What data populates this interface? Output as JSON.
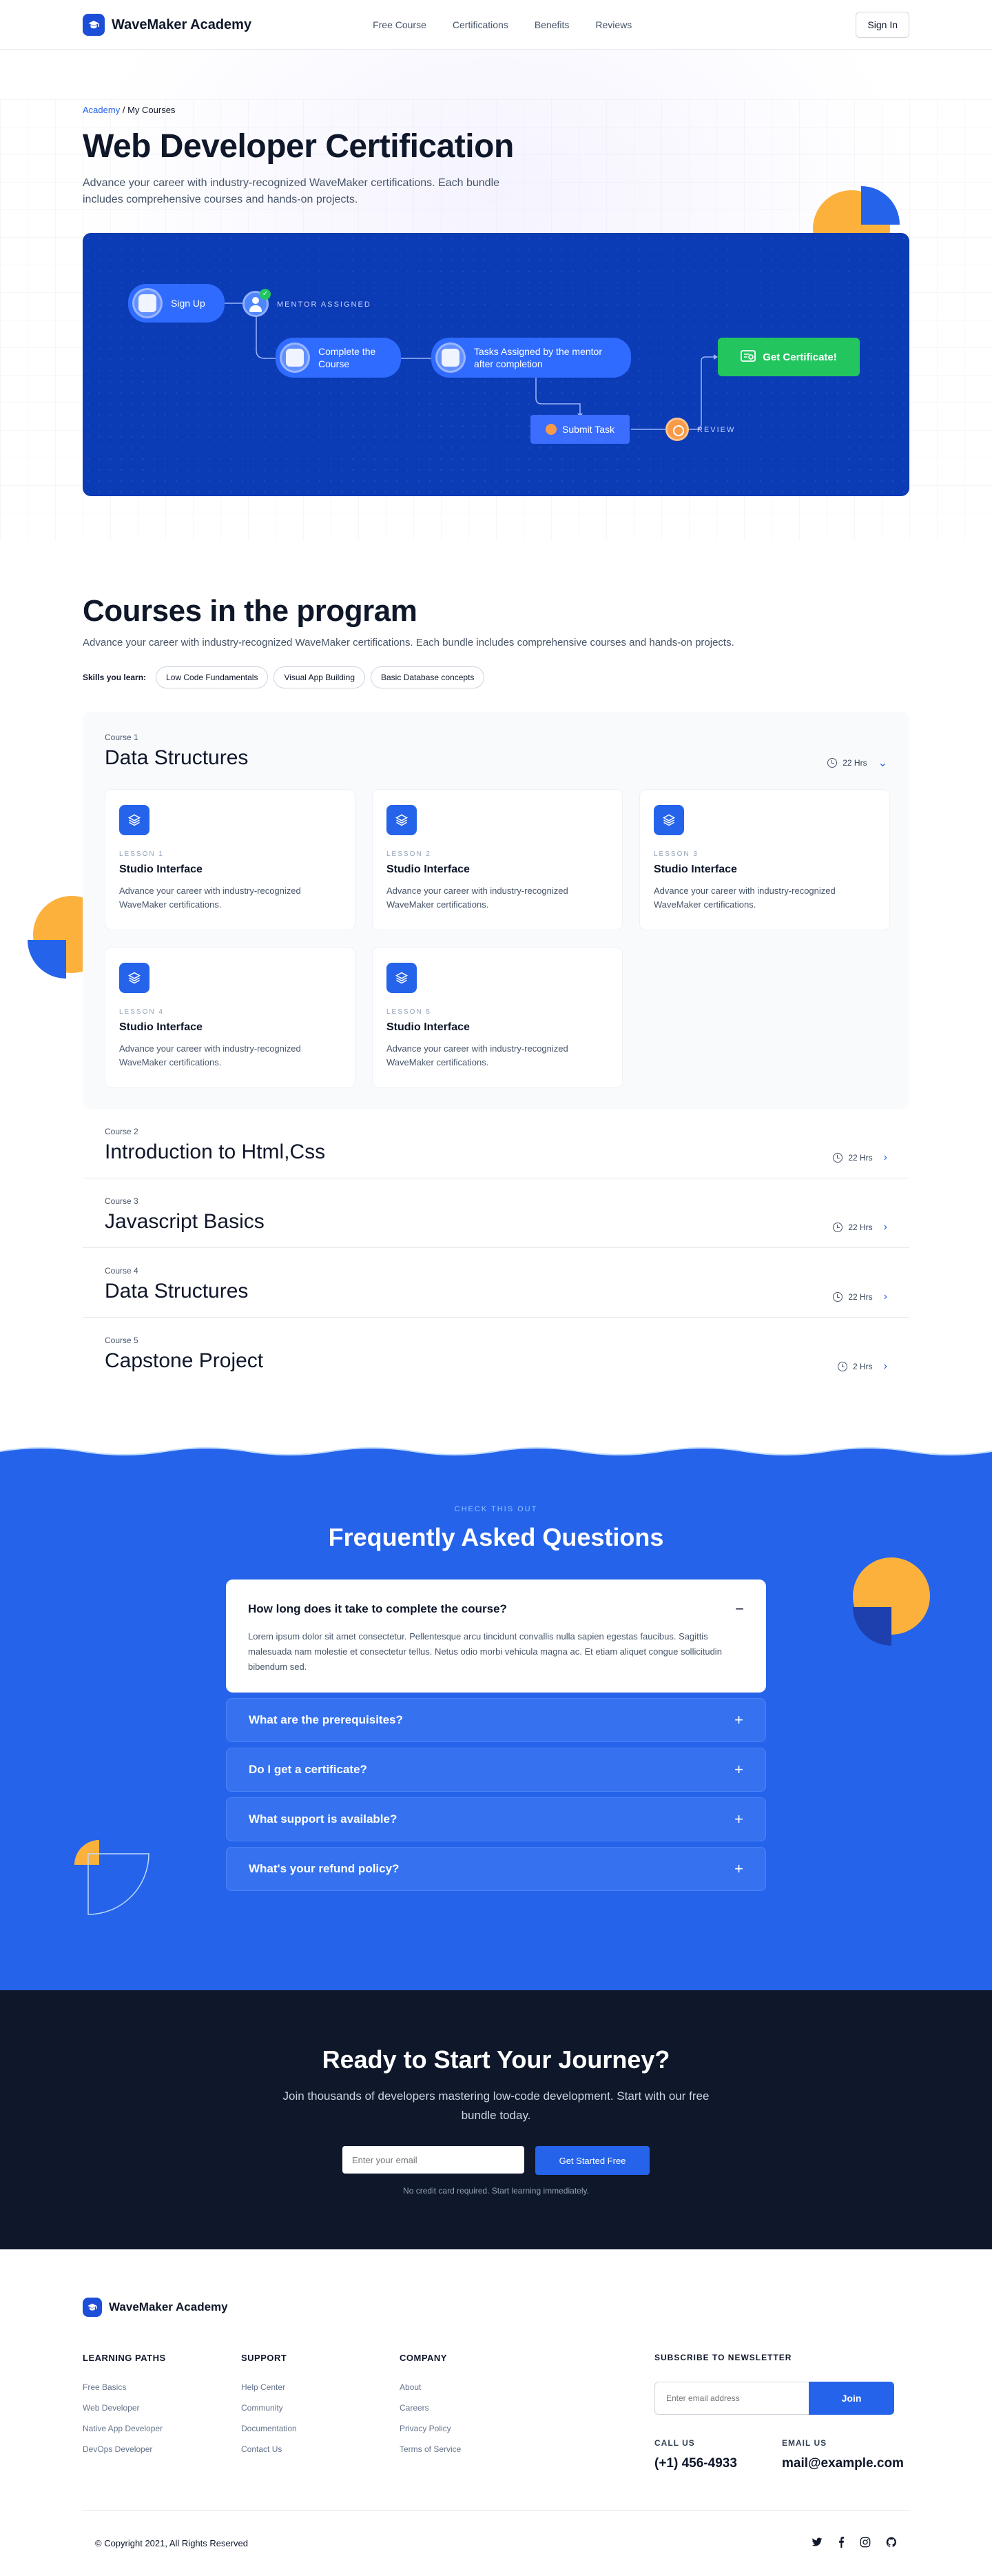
{
  "nav": {
    "brand": "WaveMaker Academy",
    "links": [
      "Free Course",
      "Certifications",
      "Benefits",
      "Reviews"
    ],
    "signin": "Sign In"
  },
  "hero": {
    "breadcrumb_link": "Academy",
    "breadcrumb_sep": "/",
    "breadcrumb_current": "My Courses",
    "title": "Web Developer Certification",
    "subtitle": "Advance your career with industry-recognized WaveMaker certifications. Each bundle includes comprehensive courses and hands-on projects.",
    "flow": {
      "sign_up": "Sign Up",
      "mentor_assigned": "MENTOR ASSIGNED",
      "complete_course": "Complete the Course",
      "tasks_assigned": "Tasks Assigned by the mentor after completion",
      "submit_task": "Submit Task",
      "review": "REVIEW",
      "get_certificate": "Get Certificate!"
    }
  },
  "courses": {
    "title": "Courses in the program",
    "subtitle": "Advance your career with industry-recognized WaveMaker certifications. Each bundle includes comprehensive courses and hands-on projects.",
    "skills_label": "Skills you learn:",
    "skills": [
      "Low Code Fundamentals",
      "Visual App Building",
      "Basic Database concepts"
    ],
    "open": {
      "num": "Course 1",
      "title": "Data Structures",
      "hours": "22 Hrs",
      "lessons": [
        {
          "tag": "LESSON 1",
          "title": "Studio Interface",
          "desc": "Advance your career with industry-recognized WaveMaker certifications."
        },
        {
          "tag": "LESSON 2",
          "title": "Studio Interface",
          "desc": "Advance your career with industry-recognized WaveMaker certifications."
        },
        {
          "tag": "LESSON 3",
          "title": "Studio Interface",
          "desc": "Advance your career with industry-recognized WaveMaker certifications."
        },
        {
          "tag": "LESSON 4",
          "title": "Studio Interface",
          "desc": "Advance your career with industry-recognized WaveMaker certifications."
        },
        {
          "tag": "LESSON 5",
          "title": "Studio Interface",
          "desc": "Advance your career with industry-recognized WaveMaker certifications."
        }
      ]
    },
    "rows": [
      {
        "num": "Course 2",
        "title": "Introduction to Html,Css",
        "hours": "22 Hrs"
      },
      {
        "num": "Course 3",
        "title": "Javascript Basics",
        "hours": "22 Hrs"
      },
      {
        "num": "Course 4",
        "title": "Data Structures",
        "hours": "22 Hrs"
      },
      {
        "num": "Course 5",
        "title": "Capstone Project",
        "hours": "2 Hrs"
      }
    ]
  },
  "faq": {
    "eyebrow": "CHECK THIS OUT",
    "title": "Frequently Asked Questions",
    "open": {
      "q": "How long does it take to complete the course?",
      "a": "Lorem ipsum dolor sit amet consectetur. Pellentesque arcu tincidunt convallis nulla sapien egestas faucibus. Sagittis malesuada nam molestie et consectetur tellus. Netus odio morbi vehicula magna ac. Et etiam aliquet congue sollicitudin bibendum sed.",
      "sign": "−"
    },
    "closed": [
      {
        "q": "What are the prerequisites?",
        "sign": "+"
      },
      {
        "q": "Do I get a certificate?",
        "sign": "+"
      },
      {
        "q": "What support is available?",
        "sign": "+"
      },
      {
        "q": "What's your refund policy?",
        "sign": "+"
      }
    ]
  },
  "cta": {
    "title": "Ready to Start Your Journey?",
    "subtitle": "Join thousands of developers mastering low-code development. Start with our free bundle today.",
    "email_placeholder": "Enter your email",
    "button": "Get Started Free",
    "note": "No credit card required. Start learning immediately."
  },
  "footer": {
    "brand": "WaveMaker Academy",
    "cols": [
      {
        "title": "LEARNING PATHS",
        "links": [
          "Free Basics",
          "Web Developer",
          "Native App Developer",
          "DevOps Developer"
        ]
      },
      {
        "title": "SUPPORT",
        "links": [
          "Help Center",
          "Community",
          "Documentation",
          "Contact Us"
        ]
      },
      {
        "title": "COMPANY",
        "links": [
          "About",
          "Careers",
          "Privacy Policy",
          "Terms of Service"
        ]
      }
    ],
    "newsletter_title": "SUBSCRIBE TO NEWSLETTER",
    "newsletter_placeholder": "Enter email address",
    "newsletter_button": "Join",
    "call_label": "CALL US",
    "call_value": "(+1) 456-4933",
    "email_label": "EMAIL US",
    "email_value": "mail@example.com",
    "copyright": "© Copyright 2021, All Rights Reserved"
  },
  "colors": {
    "primary": "#2563eb",
    "flow_bg": "#0b3bb5",
    "success": "#22c55e",
    "accent_orange": "#fbb13c",
    "dark": "#0f172a"
  },
  "icons": [
    "graduation-cap-icon",
    "clock-icon",
    "chevron-down-icon",
    "chevron-right-icon",
    "layers-icon",
    "twitter-icon",
    "facebook-icon",
    "instagram-icon",
    "github-icon"
  ]
}
